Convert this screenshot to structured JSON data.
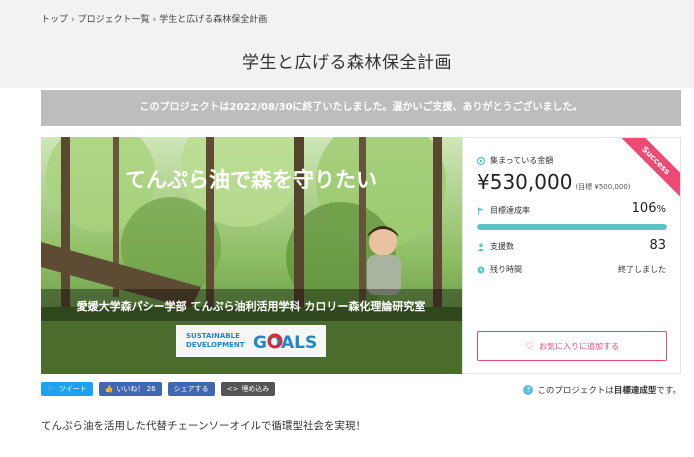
{
  "breadcrumb": {
    "items": [
      "トップ",
      "プロジェクト一覧",
      "学生と広げる森林保全計画"
    ],
    "separator": "›"
  },
  "page": {
    "title": "学生と広げる森林保全計画"
  },
  "notice": {
    "text": "このプロジェクトは2022/08/30に終了いたしました。温かいご支援、ありがとうございました。"
  },
  "hero": {
    "headline": "てんぷら油で森を守りたい",
    "lab_caption": "愛媛大学森パシー学部 てんぷら油利活用学科 カロリー森化理論研究室",
    "sdgs_line1": "SUSTAINABLE",
    "sdgs_line2": "DEVELOPMENT",
    "sdgs_goals": "GOALS"
  },
  "panel": {
    "ribbon": "Success",
    "collected_label": "集まっている金額",
    "amount": "¥530,000",
    "target": "(目標 ¥500,000)",
    "rate_label": "目標達成率",
    "rate_value": "106",
    "rate_unit": "%",
    "progress_fraction": 1.0,
    "supporters_label": "支援数",
    "supporters_value": "83",
    "remaining_label": "残り時間",
    "remaining_value": "終了しました",
    "favorite_label": "お気に入りに追加する"
  },
  "social": {
    "tweet": "ツイート",
    "like": "いいね！ 26",
    "share": "シェアする",
    "embed": "埋め込み"
  },
  "project_type": {
    "prefix": "このプロジェクトは",
    "bold": "目標達成型",
    "suffix": "です。"
  },
  "description": "てんぷら油を活用した代替チェーンソーオイルで循環型社会を実現！",
  "colors": {
    "accent_pink": "#ea4a73",
    "progress_teal": "#59c5c7",
    "notice_gray": "#bdbdbd"
  }
}
